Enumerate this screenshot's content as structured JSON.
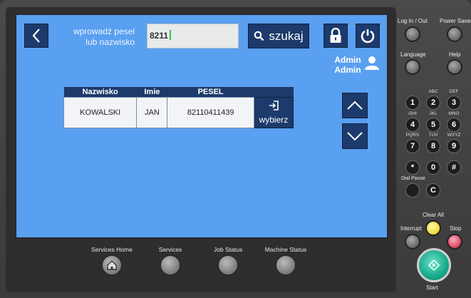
{
  "screen": {
    "prompt_line1": "wprowadź pesel",
    "prompt_line2": "lub nazwisko",
    "search_value": "8211",
    "search_label": "szukaj",
    "admin_line1": "Admin",
    "admin_line2": "Admin"
  },
  "table": {
    "headers": [
      "Nazwisko",
      "Imie",
      "PESEL"
    ],
    "rows": [
      {
        "nazwisko": "KOWALSKI",
        "imie": "JAN",
        "pesel": "82110411439",
        "action": "wybierz"
      }
    ]
  },
  "bottom_buttons": [
    "Services Home",
    "Services",
    "Job Status",
    "Machine Status"
  ],
  "side": {
    "login": "Log In / Out",
    "power_saver": "Power Saver",
    "language": "Language",
    "help": "Help",
    "dial_pause": "Dial Pause",
    "clear_all": "Clear All",
    "interrupt": "Interrupt",
    "stop": "Stop",
    "start": "Start"
  },
  "keypad": [
    {
      "key": "1",
      "sub": ""
    },
    {
      "key": "2",
      "sub": "ABC"
    },
    {
      "key": "3",
      "sub": "DEF"
    },
    {
      "key": "4",
      "sub": "GHI"
    },
    {
      "key": "5",
      "sub": "JKL"
    },
    {
      "key": "6",
      "sub": "MNO"
    },
    {
      "key": "7",
      "sub": "PQRS"
    },
    {
      "key": "8",
      "sub": "TUV"
    },
    {
      "key": "9",
      "sub": "WXYZ"
    },
    {
      "key": "*",
      "sub": ""
    },
    {
      "key": "0",
      "sub": ""
    },
    {
      "key": "#",
      "sub": ""
    },
    {
      "key": "C",
      "sub": ""
    }
  ],
  "icons": {
    "back": "chevron-left-icon",
    "search": "search-icon",
    "lock": "lock-icon",
    "power": "power-icon",
    "user": "user-icon",
    "up": "chevron-up-icon",
    "down": "chevron-down-icon",
    "select": "sign-in-icon",
    "home": "home-icon"
  },
  "colors": {
    "screen_bg": "#5aa0f0",
    "button_dark": "#1c3a6b",
    "caret": "#2ccc44",
    "clear_all": "#f3e04a",
    "stop": "#e0506a",
    "start": "#18a98a"
  }
}
